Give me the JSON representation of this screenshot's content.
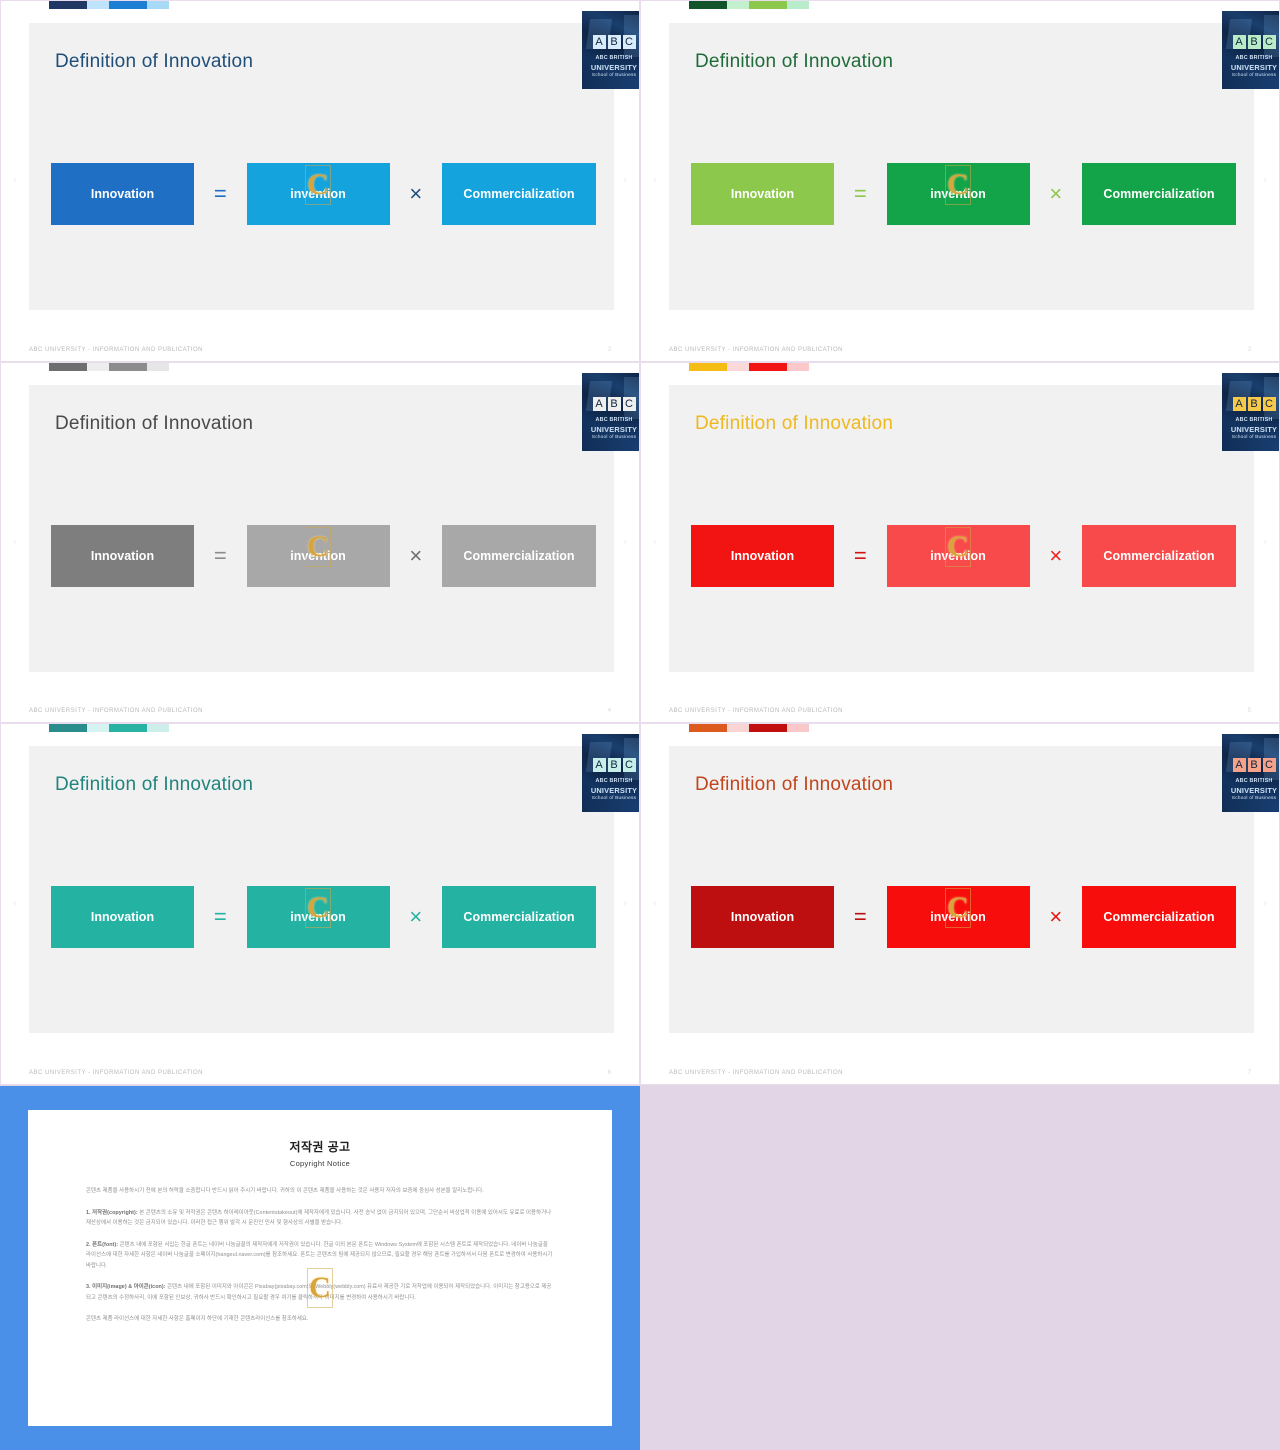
{
  "slides": [
    {
      "name": "slide-blue",
      "title": "Definition of Innovation",
      "title_color": "#1f4e79",
      "swatches": [
        "#1f3864",
        "#bee3fa",
        "#1c7fd4",
        "#a8d9f7"
      ],
      "logo_letter_bg": "#d9ecfb",
      "boxes": [
        {
          "label": "Innovation",
          "color": "#1f6fc4"
        },
        {
          "label": "invention",
          "color": "#15a3dd"
        },
        {
          "label": "Commercialization",
          "color": "#15a3dd"
        }
      ],
      "operators": [
        "=",
        "×"
      ],
      "operator_colors": [
        "#1f6fc4",
        "#1f4e79"
      ],
      "footer": "ABC UNIVERSITY - INFORMATION AND PUBLICATION",
      "page_number": "3"
    },
    {
      "name": "slide-green",
      "title": "Definition of Innovation",
      "title_color": "#1f6b3a",
      "swatches": [
        "#14542a",
        "#c3f0cf",
        "#8cc84b",
        "#b9eccb"
      ],
      "logo_letter_bg": "#b9ecc6",
      "boxes": [
        {
          "label": "Innovation",
          "color": "#8cc84b"
        },
        {
          "label": "invention",
          "color": "#13a349"
        },
        {
          "label": "Commercialization",
          "color": "#13a349"
        }
      ],
      "operators": [
        "=",
        "×"
      ],
      "operator_colors": [
        "#8cc84b",
        "#8cc84b"
      ],
      "footer": "ABC UNIVERSITY - INFORMATION AND PUBLICATION",
      "page_number": "3"
    },
    {
      "name": "slide-gray",
      "title": "Definition of Innovation",
      "title_color": "#4a4a4a",
      "swatches": [
        "#6e6e6e",
        "#ededed",
        "#8c8c8c",
        "#e6e6e6"
      ],
      "logo_letter_bg": "#efefef",
      "boxes": [
        {
          "label": "Innovation",
          "color": "#7e7e7e"
        },
        {
          "label": "invention",
          "color": "#a8a8a8"
        },
        {
          "label": "Commercialization",
          "color": "#a8a8a8"
        }
      ],
      "operators": [
        "=",
        "×"
      ],
      "operator_colors": [
        "#8c8c8c",
        "#6e6e6e"
      ],
      "footer": "ABC UNIVERSITY - INFORMATION AND PUBLICATION",
      "page_number": "4"
    },
    {
      "name": "slide-red-yellow",
      "title": "Definition of Innovation",
      "title_color": "#eeb81f",
      "swatches": [
        "#f5bc16",
        "#fbd9d9",
        "#f21313",
        "#fbc9c9"
      ],
      "logo_letter_bg": "#f7c94a",
      "boxes": [
        {
          "label": "Innovation",
          "color": "#f21313"
        },
        {
          "label": "invention",
          "color": "#f84a4a"
        },
        {
          "label": "Commercialization",
          "color": "#f84a4a"
        }
      ],
      "operators": [
        "=",
        "×"
      ],
      "operator_colors": [
        "#d61212",
        "#ef2020"
      ],
      "footer": "ABC UNIVERSITY - INFORMATION AND PUBLICATION",
      "page_number": "5"
    },
    {
      "name": "slide-teal",
      "title": "Definition of Innovation",
      "title_color": "#21837c",
      "swatches": [
        "#2b8c8c",
        "#d5f3f0",
        "#27b2a4",
        "#cdeeea"
      ],
      "logo_letter_bg": "#c6efea",
      "boxes": [
        {
          "label": "Innovation",
          "color": "#24b2a3"
        },
        {
          "label": "invention",
          "color": "#24b2a3"
        },
        {
          "label": "Commercialization",
          "color": "#24b2a3"
        }
      ],
      "operators": [
        "=",
        "×"
      ],
      "operator_colors": [
        "#24b2a3",
        "#24b2a3"
      ],
      "footer": "ABC UNIVERSITY - INFORMATION AND PUBLICATION",
      "page_number": "6"
    },
    {
      "name": "slide-dark-red",
      "title": "Definition of Innovation",
      "title_color": "#c0451c",
      "swatches": [
        "#dd5a1e",
        "#fbd4d4",
        "#c10e0e",
        "#fac8c8"
      ],
      "logo_letter_bg": "#f6a18a",
      "boxes": [
        {
          "label": "Innovation",
          "color": "#bd0f10"
        },
        {
          "label": "invention",
          "color": "#f80d0d"
        },
        {
          "label": "Commercialization",
          "color": "#f80d0d"
        }
      ],
      "operators": [
        "=",
        "×"
      ],
      "operator_colors": [
        "#bd0f10",
        "#e51414"
      ],
      "footer": "ABC UNIVERSITY - INFORMATION AND PUBLICATION",
      "page_number": "7"
    }
  ],
  "logo": {
    "letters": [
      "A",
      "B",
      "C"
    ],
    "line1": "ABC BRITISH",
    "line2": "UNIVERSITY",
    "line3": "School of Business"
  },
  "nav": {
    "prev": "‹",
    "next": "›"
  },
  "watermark": {
    "letter": "C"
  },
  "copyright": {
    "title": "저작권 공고",
    "subtitle": "Copyright Notice",
    "intro": "콘텐츠 제품을 사용하시기 전에 본의 허락을 소중합니다 반드시 읽어 주시기 바랍니다. 귀하의 이 콘텐츠 제품을 사용하는 것은 사용자 저자의 보증에 중심사 성본을 알리노럽니다.",
    "sections": [
      {
        "heading": "1. 저작권(copyright):",
        "text": " 본 콘텐츠의 소유 및 저작권은 콘텐츠 하이레이아웃(Contentstakeout)에 제작자에게 있습니다. 사전 승낙 없이 금지되어 있으며, 그단순서 비상업적 이용에 있어서도 유료로 이용하거나 재산상에서 이용하는 것은 금지되어 있습니다. 이러한 접근 행위 발각 시 문진인 민사 및 형사상의 사별을 받습니다."
      },
      {
        "heading": "2. 폰트(font):",
        "text": " 콘텐츠 내에 포함된 서입는 한글 폰트는 네이버 나눔글꼴의 제작자에게 저작권이 있습니다. 한글 이외 본문 폰트는 Windows System에 포함된 시스템 폰트로 제작되었습니다. 네이버 나눔글꼴 라이선스에 대한 자세한 사항은 네이버 나눔글꼴 소페이지(hangeul.naver.com)를 참조하세요. 폰트는 콘텐츠의 팀에 제공되지 않으므로, 필요할 경우 해당 폰트를 가입하셔서 다음 폰트로 변경하여 사용하시기 바랍니다."
      },
      {
        "heading": "3. 이미지(image) & 아이콘(icon):",
        "text": " 콘텐츠 내에 포함된 이미지와 아이콘은 Pixabay(pixabay.com)와 Webbly(webbly.com) 유료사 제공한 기로 저작업에 이용되어 제작되었습니다. 이미지는 참고용으로 제공되고 콘텐츠의 수정하사리, 이에 포함된 인보상, 귀하사 반드시 확인하시고 필요할 경우 여기를 클릭하셔다 이미지를 변경하여 사용하시기 바랍니다."
      }
    ],
    "outro": "콘텐츠 제품 라이선스에 대한 자세한 사항은 홈페이지 하단에 기재한 콘텐츠라이선스를 참조하세요."
  }
}
